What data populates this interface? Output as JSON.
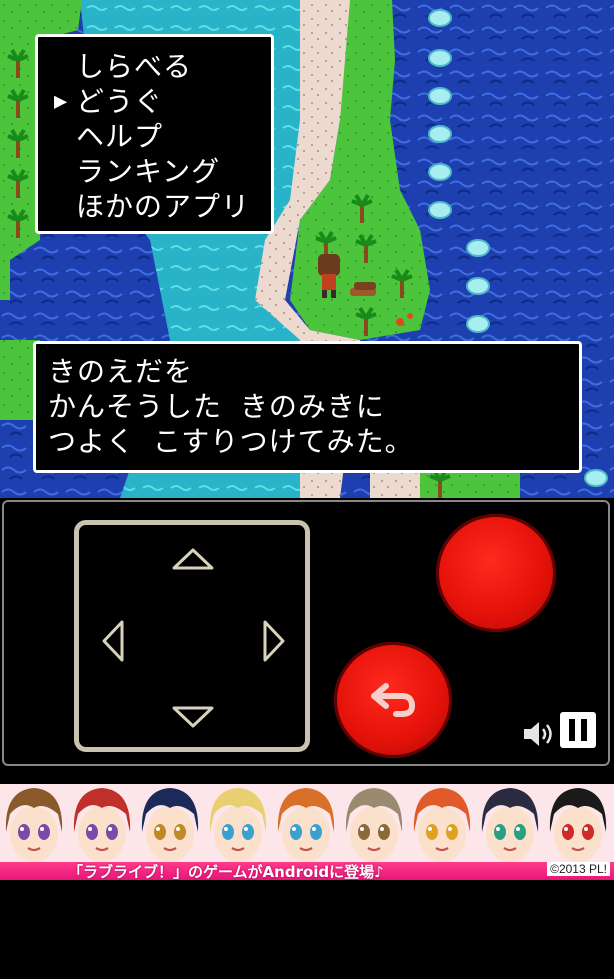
{
  "menu": {
    "items": [
      "しらべる",
      "どうぐ",
      "ヘルプ",
      "ランキング",
      "ほかのアプリ"
    ],
    "selected": 1,
    "cursor": "▶"
  },
  "message": {
    "lines": [
      "きのえだを",
      "かんそうした きのみきに",
      "つよく こすりつけてみた。"
    ]
  },
  "controls": {
    "back_icon": "↶",
    "sound_icon": "🔊",
    "pause_icon": "pause-icon"
  },
  "banner": {
    "text": "「ラブライブ！」のゲームがAndroidに登場♪",
    "copyright": "©2013 PL!"
  },
  "colors": {
    "sea": "#1a3fa8",
    "shallow": "#2bb4c8",
    "grass": "#49c23a",
    "sand": "#e8d4c8",
    "button_red": "#e5120a",
    "caption_pink": "#ee1f80"
  }
}
